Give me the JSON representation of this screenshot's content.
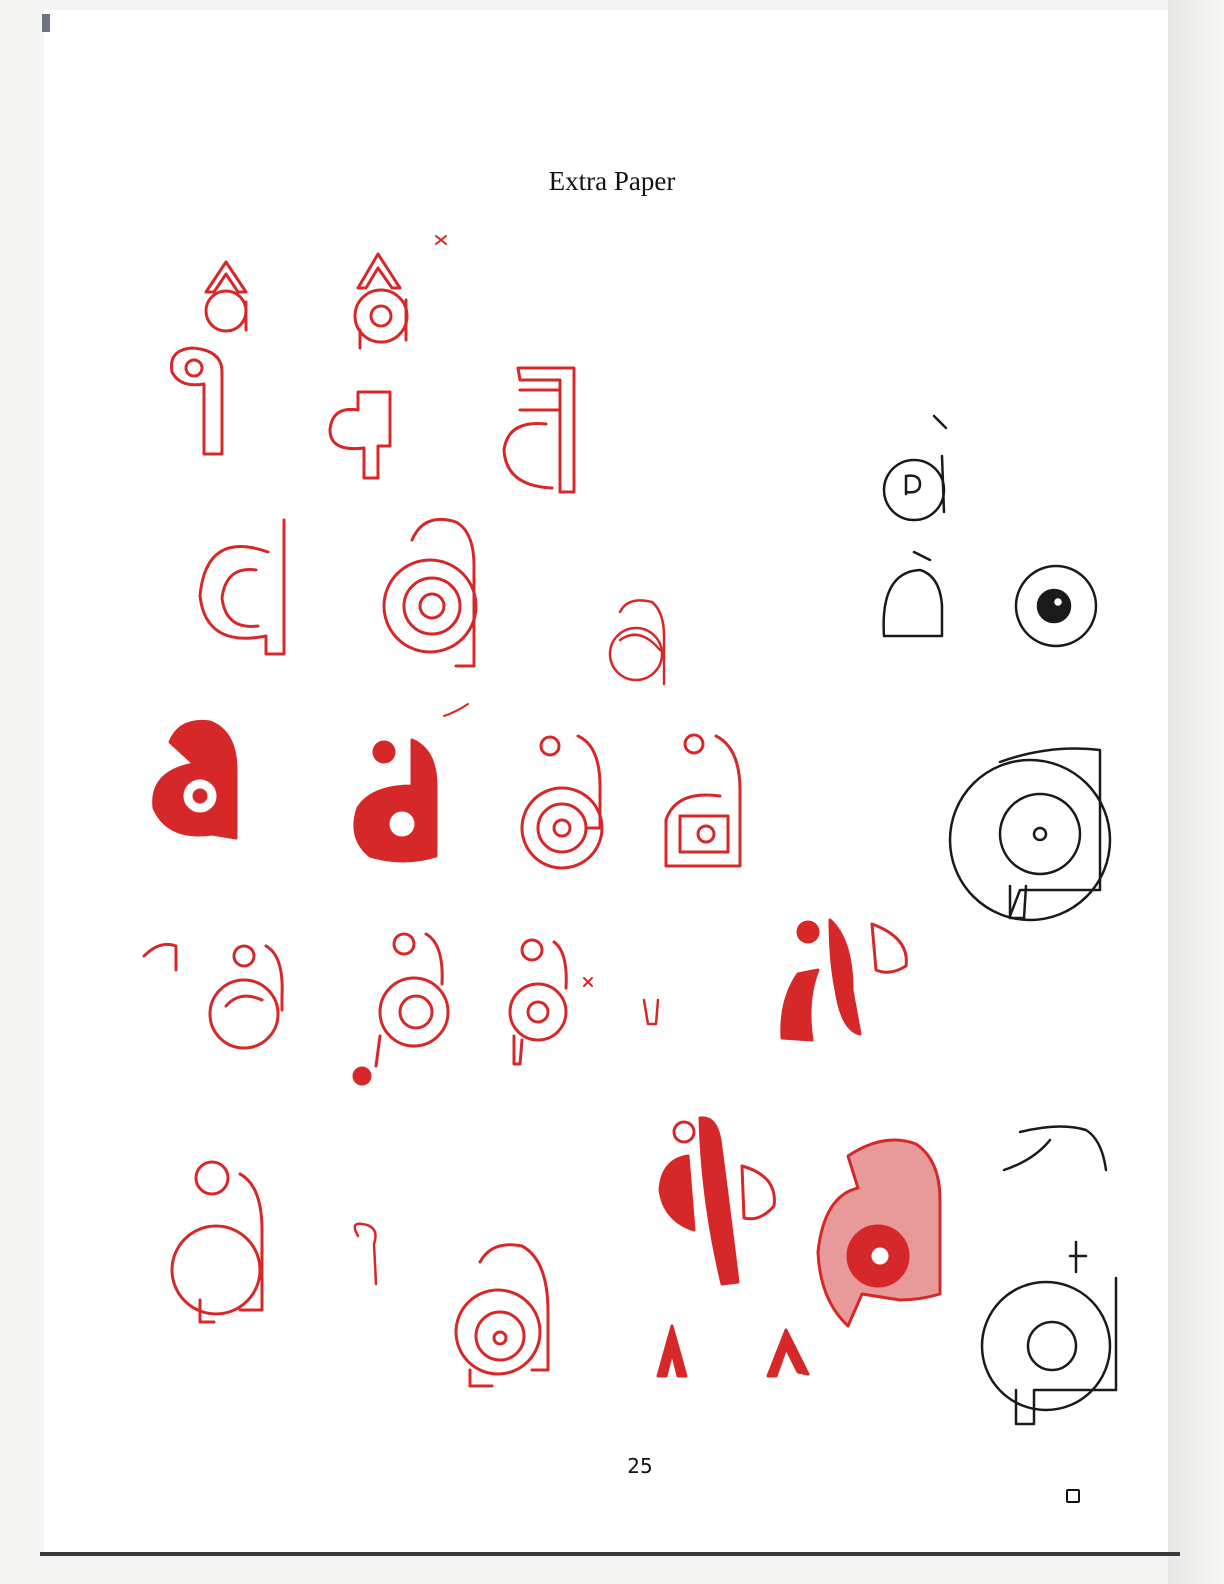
{
  "document": {
    "title": "Extra Paper",
    "page_number": "25"
  },
  "colors": {
    "ink_red": "#d62828",
    "ink_dark": "#1a1a1a",
    "paper": "#ffffff"
  },
  "icons": {
    "checkbox": "checkbox-icon"
  }
}
